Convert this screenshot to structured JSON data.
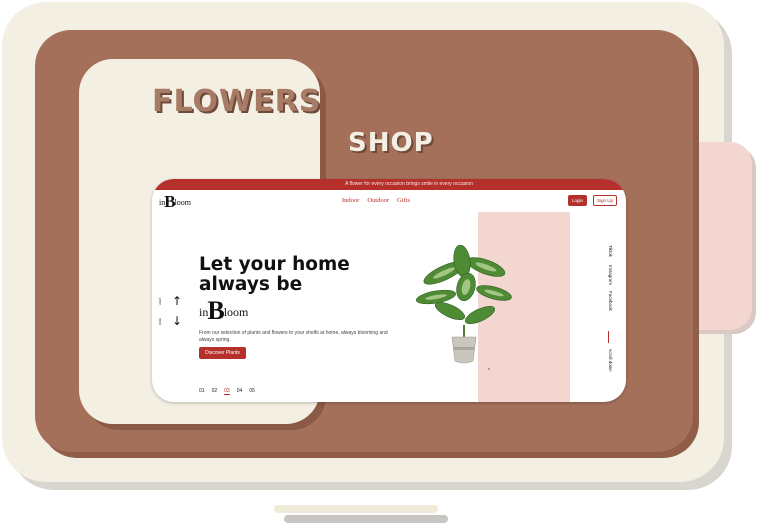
{
  "poster": {
    "title_word1": "FLOWERS",
    "title_word2": "SHOP"
  },
  "site": {
    "announcement": "A flower for every occasion brings smile in every occasion",
    "logo": {
      "prefix": "in",
      "big": "B",
      "suffix": "loom"
    },
    "nav": [
      "Indoor",
      "Outdoor",
      "Gifts"
    ],
    "login_label": "Login",
    "signup_label": "Sign Up",
    "arrows": {
      "prev_label": "prev",
      "next_label": "next"
    },
    "hero": {
      "line1": "Let your home",
      "line2": "always be",
      "logo": {
        "prefix": "in",
        "big": "B",
        "suffix": "loom"
      },
      "description": "From our selection of plants and flowers to your shelfs at home, always blooming and always spring.",
      "cta_label": "Discover Plants"
    },
    "pages": [
      "01",
      "02",
      "03",
      "04",
      "05"
    ],
    "active_page": "03",
    "social": [
      "Tiktok",
      "Instagram",
      "Facebook"
    ],
    "scroll_label": "scroll down",
    "colors": {
      "accent": "#b5302b",
      "pink": "#f4d6d1",
      "brown": "#a5705a",
      "cream": "#f4efe3"
    }
  }
}
